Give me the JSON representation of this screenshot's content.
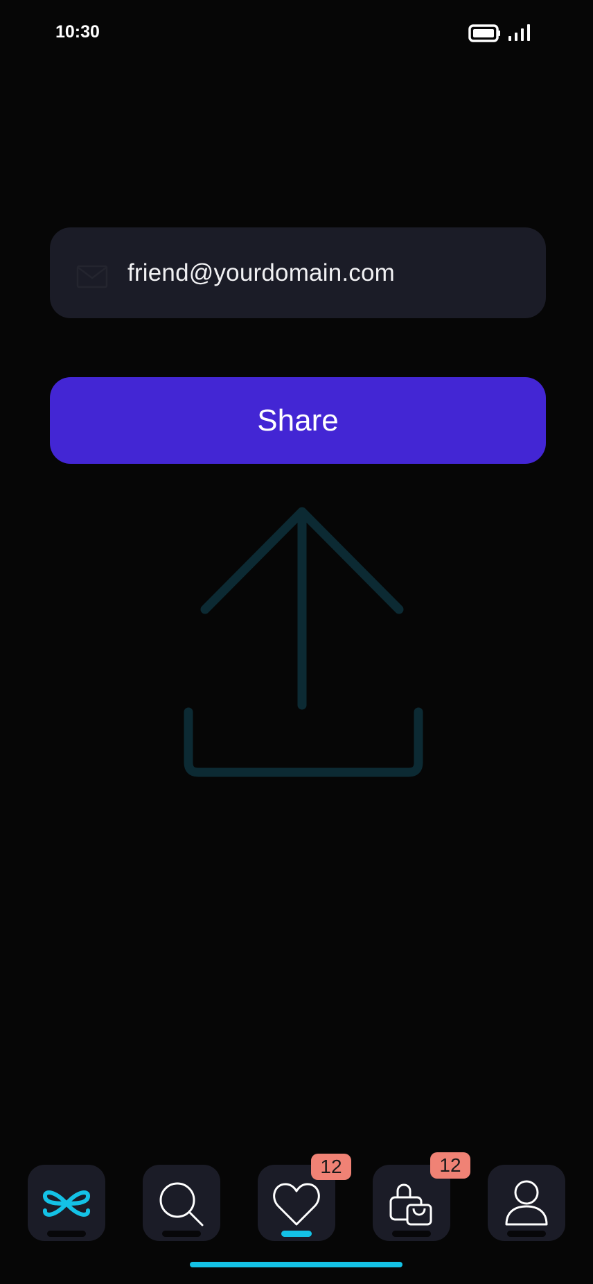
{
  "status_bar": {
    "time": "10:30",
    "icons": [
      "battery-icon",
      "signal-icon"
    ]
  },
  "share_form": {
    "email_icon": "mail-icon",
    "email_value": "friend@yourdomain.com",
    "share_label": "Share"
  },
  "illustration": {
    "icon": "upload-icon",
    "color": "#0c2a33"
  },
  "tab_bar": {
    "tabs": [
      {
        "name": "home",
        "icon": "logo-icon",
        "active": false
      },
      {
        "name": "search",
        "icon": "search-icon",
        "active": false
      },
      {
        "name": "favorites",
        "icon": "heart-icon",
        "active": true,
        "badge": "12"
      },
      {
        "name": "bag",
        "icon": "shopping-bag-icon",
        "active": false,
        "badge": "12"
      },
      {
        "name": "profile",
        "icon": "user-icon",
        "active": false
      }
    ]
  },
  "colors": {
    "background": "#060606",
    "field": "#1b1c27",
    "button": "#4326d4",
    "accent": "#14c2e6",
    "badge": "#f08275"
  }
}
